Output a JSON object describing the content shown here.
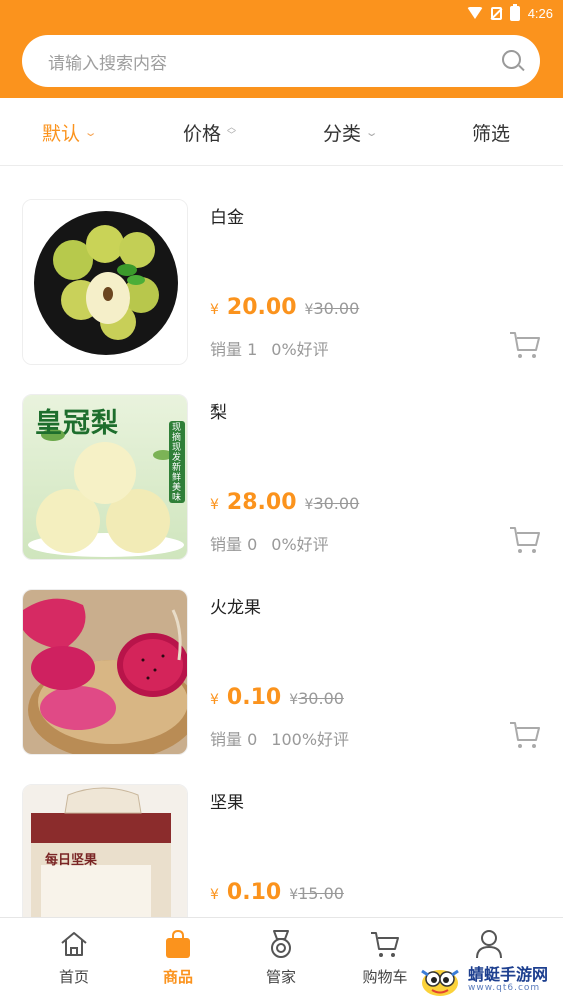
{
  "status_bar": {
    "time": "4:26"
  },
  "search": {
    "placeholder": "请输入搜索内容"
  },
  "sort_bar": [
    {
      "label": "默认",
      "indicator": "chevron-down",
      "active": true
    },
    {
      "label": "价格",
      "indicator": "up-down",
      "active": false
    },
    {
      "label": "分类",
      "indicator": "chevron-down",
      "active": false
    },
    {
      "label": "筛选",
      "indicator": "none",
      "active": false
    }
  ],
  "products": [
    {
      "name": "白金",
      "currency": "¥",
      "price": "20.00",
      "original_currency": "¥",
      "original_price": "30.00",
      "sales": "销量 1",
      "rating": "0%好评"
    },
    {
      "name": "梨",
      "currency": "¥",
      "price": "28.00",
      "original_currency": "¥",
      "original_price": "30.00",
      "sales": "销量 0",
      "rating": "0%好评",
      "image_text": "皇冠梨",
      "image_badge": "现摘现发 新鲜美味"
    },
    {
      "name": "火龙果",
      "currency": "¥",
      "price": "0.10",
      "original_currency": "¥",
      "original_price": "30.00",
      "sales": "销量 0",
      "rating": "100%好评"
    },
    {
      "name": "坚果",
      "currency": "¥",
      "price": "0.10",
      "original_currency": "¥",
      "original_price": "15.00",
      "sales": "",
      "rating": "",
      "image_text": "每日坚果"
    }
  ],
  "tabbar": [
    {
      "label": "首页",
      "icon": "home-icon",
      "active": false
    },
    {
      "label": "商品",
      "icon": "shopping-bag-icon",
      "active": true
    },
    {
      "label": "管家",
      "icon": "medal-icon",
      "active": false
    },
    {
      "label": "购物车",
      "icon": "cart-icon",
      "active": false
    },
    {
      "label": "我的",
      "icon": "user-icon",
      "active": false
    }
  ],
  "watermark": {
    "text": "蜻蜓手游网",
    "sub": "www.qt6.com"
  },
  "colors": {
    "accent": "#fb931d",
    "muted": "#999999",
    "divider": "#ececec"
  }
}
